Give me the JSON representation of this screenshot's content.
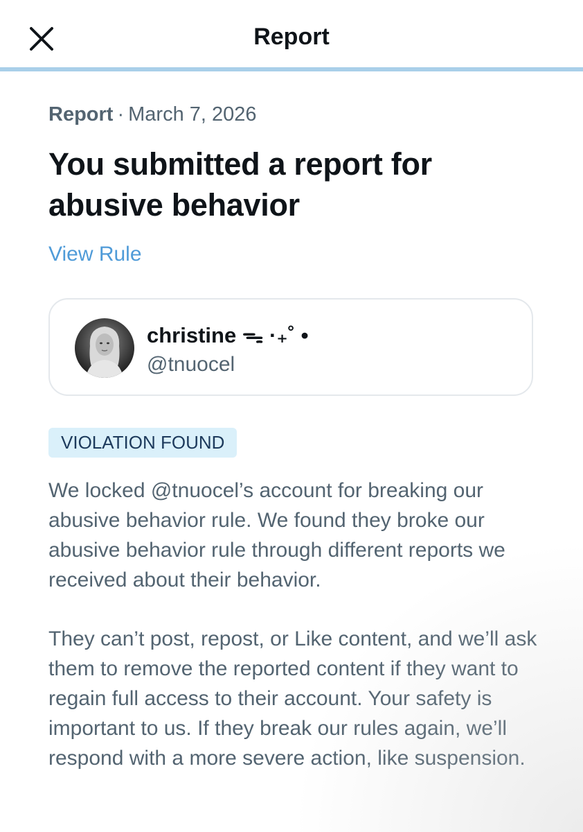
{
  "header": {
    "title": "Report",
    "close_icon": "close-icon"
  },
  "report": {
    "kind": "Report",
    "separator": "·",
    "date": "March 7, 2026",
    "headline": "You submitted a report for abusive behavior",
    "view_rule_label": "View Rule"
  },
  "reported_user": {
    "display_name": "christine ᯓ ·₊˚ •",
    "handle": "@tnuocel",
    "avatar": "user-avatar-photo"
  },
  "status_badge": "VIOLATION FOUND",
  "body": {
    "paragraph_1": "We locked @tnuocel’s account for breaking our abusive behavior rule. We found they broke our abusive behavior rule through different reports we received about their behavior.",
    "paragraph_2": "They can’t post, repost, or Like content, and we’ll ask them to remove the reported content if they want to regain full access to their account. Your safety is important to us. If they break our rules again, we’ll respond with a more severe action, like suspension."
  },
  "colors": {
    "link": "#4f9bd8",
    "badge_bg": "#daf0fa",
    "badge_text": "#1d3a5c",
    "secondary_text": "#536471",
    "progress": "#a9cfe9"
  }
}
